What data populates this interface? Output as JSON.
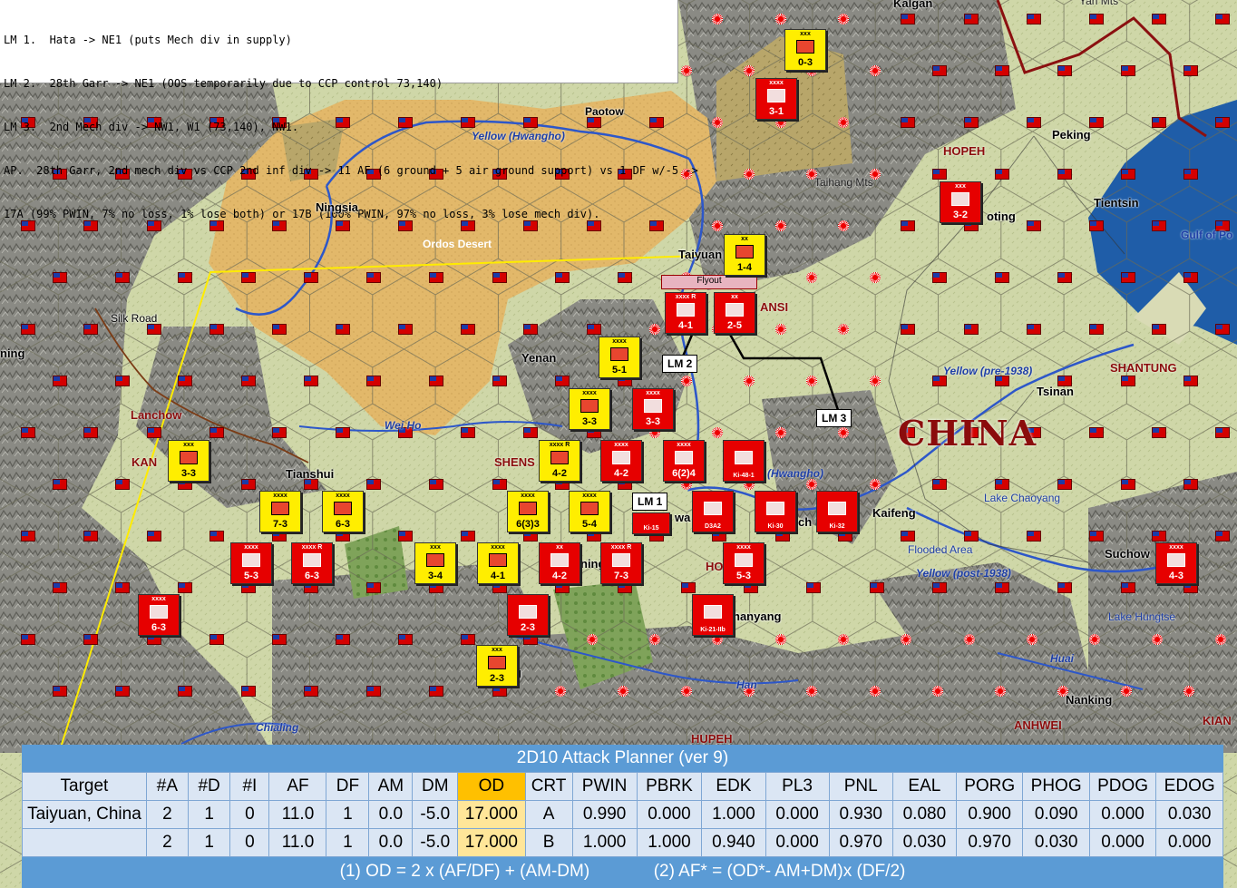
{
  "notes": [
    "LM 1.  Hata -> NE1 (puts Mech div in supply)",
    "LM 2.  28th Garr -> NE1 (OOS temporarily due to CCP control 73,140)",
    "LM 3.  2nd Mech div -> NW1, W1 (73,140), NW1.",
    "AP.  28th Garr, 2nd mech div vs CCP 2nd inf div -> 11 AF (6 ground + 5 air ground support) vs 1 DF w/-5 ->",
    "17A (99% PWIN, 7% no loss, 1% lose both) or 17B (100% PWIN, 97% no loss, 3% lose mech div)."
  ],
  "map": {
    "cities": [
      "Kalgan",
      "Paotow",
      "Peking",
      "Tientsin",
      "Ningsia",
      "Taiyuan",
      "Yenan",
      "Tsinan",
      "Kaifeng",
      "Lanchow",
      "Tianshui",
      "Suchow",
      "Nanking",
      "Paoting",
      "Loyang",
      "Hanyang"
    ],
    "city_labels": {
      "kalgan": "Kalgan",
      "paotow": "Paotow",
      "peking": "Peking",
      "tientsin": "Tientsin",
      "ningsia": "Ningsia",
      "taiyuan": "Taiyuan",
      "yenan": "Yenan",
      "tsinan": "Tsinan",
      "kaifeng": "Kaifeng",
      "lanchow": "Lanchow",
      "tianshui": "Tianshui",
      "suchow": "Suchow",
      "nanking": "Nanking",
      "oting": "oting",
      "ning": "ning",
      "hanyang": "hanyang",
      "wa": "wa",
      "ch": "ch",
      "g": "g"
    },
    "rivers": {
      "yellow_hwangho": "Yellow (Hwangho)",
      "yellow_pre": "Yellow (pre-1938)",
      "yellow_post": "Yellow (post-1938)",
      "hwangho2": "(Hwangho)",
      "wei_ho": "Wei Ho",
      "han": "Han",
      "huai": "Huai",
      "chialing": "Chialing"
    },
    "provinces": {
      "hopeh": "HOPEH",
      "shantung": "SHANTUNG",
      "shensi": "SHENS",
      "ansi": "ANSI",
      "kansu": "KAN",
      "anhwei": "ANHWEI",
      "hupeh": "HUPEH",
      "ho": "HO",
      "kian": "KIAN"
    },
    "country": "CHINA",
    "features": {
      "ordos": "Ordos Desert",
      "taihang": "Taihang Mts",
      "yan_mts": "Yan Mts",
      "silk_road": "Silk Road",
      "gulf": "Gulf of Po",
      "lake_chaoyang": "Lake Chaoyang",
      "flooded": "Flooded Area",
      "lake_hungtse": "Lake Hungtse",
      "ming": "ning"
    },
    "callouts": {
      "lm1": "LM 1",
      "lm2": "LM 2",
      "lm3": "LM 3",
      "flyout": "Flyout"
    },
    "colors": {
      "land": "#cfd7a8",
      "mountain": "#8d8d86",
      "desert": "#e0b565",
      "sea": "#1f5da8",
      "red_unit": "#e60000",
      "yellow_unit": "#ffee00"
    }
  },
  "counters": [
    {
      "id": "c1",
      "color": "yellow",
      "size": "xxx",
      "str": "0-3"
    },
    {
      "id": "c2",
      "color": "red",
      "size": "xxxx",
      "str": "3-1"
    },
    {
      "id": "c3",
      "color": "red",
      "size": "xxx",
      "str": "3-2"
    },
    {
      "id": "c4",
      "color": "yellow",
      "size": "xx",
      "str": "1-4"
    },
    {
      "id": "c5",
      "color": "red",
      "size": "xxxx R",
      "str": "4-1"
    },
    {
      "id": "c6",
      "color": "red",
      "size": "xx",
      "str": "2-5"
    },
    {
      "id": "c7",
      "color": "yellow",
      "size": "xxxx",
      "str": "5-1"
    },
    {
      "id": "c8",
      "color": "yellow",
      "size": "xxxx",
      "str": "3-3"
    },
    {
      "id": "c9",
      "color": "red",
      "size": "xxxx",
      "str": "3-3"
    },
    {
      "id": "c10",
      "color": "yellow",
      "size": "xxxx R",
      "str": "4-2"
    },
    {
      "id": "c11",
      "color": "red",
      "size": "xxxx",
      "str": "4-2"
    },
    {
      "id": "c12",
      "color": "red",
      "size": "xxxx",
      "str": "6(2)4"
    },
    {
      "id": "c13",
      "color": "red",
      "size": "",
      "str": "Ki-48-1"
    },
    {
      "id": "c14",
      "color": "yellow",
      "size": "xxx",
      "str": "3-3"
    },
    {
      "id": "c15",
      "color": "yellow",
      "size": "xxxx",
      "str": "7-3"
    },
    {
      "id": "c16",
      "color": "yellow",
      "size": "xxxx",
      "str": "6-3"
    },
    {
      "id": "c17",
      "color": "yellow",
      "size": "xxxx",
      "str": "6(3)3"
    },
    {
      "id": "c18",
      "color": "yellow",
      "size": "xxxx",
      "str": "5-4"
    },
    {
      "id": "c19",
      "color": "red",
      "size": "",
      "str": "Ki-15"
    },
    {
      "id": "c20",
      "color": "red",
      "size": "",
      "str": "D3A2"
    },
    {
      "id": "c21",
      "color": "red",
      "size": "",
      "str": "Ki-30"
    },
    {
      "id": "c22",
      "color": "red",
      "size": "",
      "str": "Ki-32"
    },
    {
      "id": "c23",
      "color": "red",
      "size": "xxxx",
      "str": "5-3"
    },
    {
      "id": "c24",
      "color": "red",
      "size": "xxxx R",
      "str": "6-3"
    },
    {
      "id": "c25",
      "color": "yellow",
      "size": "xxx",
      "str": "3-4"
    },
    {
      "id": "c26",
      "color": "yellow",
      "size": "xxxx",
      "str": "4-1"
    },
    {
      "id": "c27",
      "color": "red",
      "size": "xx",
      "str": "4-2"
    },
    {
      "id": "c28",
      "color": "red",
      "size": "xxxx R",
      "str": "7-3"
    },
    {
      "id": "c29",
      "color": "red",
      "size": "xxxx",
      "str": "5-3"
    },
    {
      "id": "c30",
      "color": "red",
      "size": "xxxx",
      "str": "6-3"
    },
    {
      "id": "c31",
      "color": "red",
      "size": "",
      "str": "2-3"
    },
    {
      "id": "c32",
      "color": "red",
      "size": "",
      "str": "Ki-21-IIb"
    },
    {
      "id": "c33",
      "color": "yellow",
      "size": "xxx",
      "str": "2-3"
    },
    {
      "id": "c34",
      "color": "red",
      "size": "xxxx",
      "str": "4-3"
    }
  ],
  "planner": {
    "title": "2D10 Attack Planner (ver 9)",
    "headers": [
      "Target",
      "#A",
      "#D",
      "#I",
      "AF",
      "DF",
      "AM",
      "DM",
      "OD",
      "CRT",
      "PWIN",
      "PBRK",
      "EDK",
      "PL3",
      "PNL",
      "EAL",
      "PORG",
      "PHOG",
      "PDOG",
      "EDOG"
    ],
    "rows": [
      [
        "Taiyuan, China",
        "2",
        "1",
        "0",
        "11.0",
        "1",
        "0.0",
        "-5.0",
        "17.000",
        "A",
        "0.990",
        "0.000",
        "1.000",
        "0.000",
        "0.930",
        "0.080",
        "0.900",
        "0.090",
        "0.000",
        "0.030"
      ],
      [
        "",
        "2",
        "1",
        "0",
        "11.0",
        "1",
        "0.0",
        "-5.0",
        "17.000",
        "B",
        "1.000",
        "1.000",
        "0.940",
        "0.000",
        "0.970",
        "0.030",
        "0.970",
        "0.030",
        "0.000",
        "0.000"
      ]
    ],
    "formula1": "(1) OD = 2 x (AF/DF) + (AM-DM)",
    "formula2": "(2) AF* = (OD*- AM+DM)x (DF/2)"
  }
}
